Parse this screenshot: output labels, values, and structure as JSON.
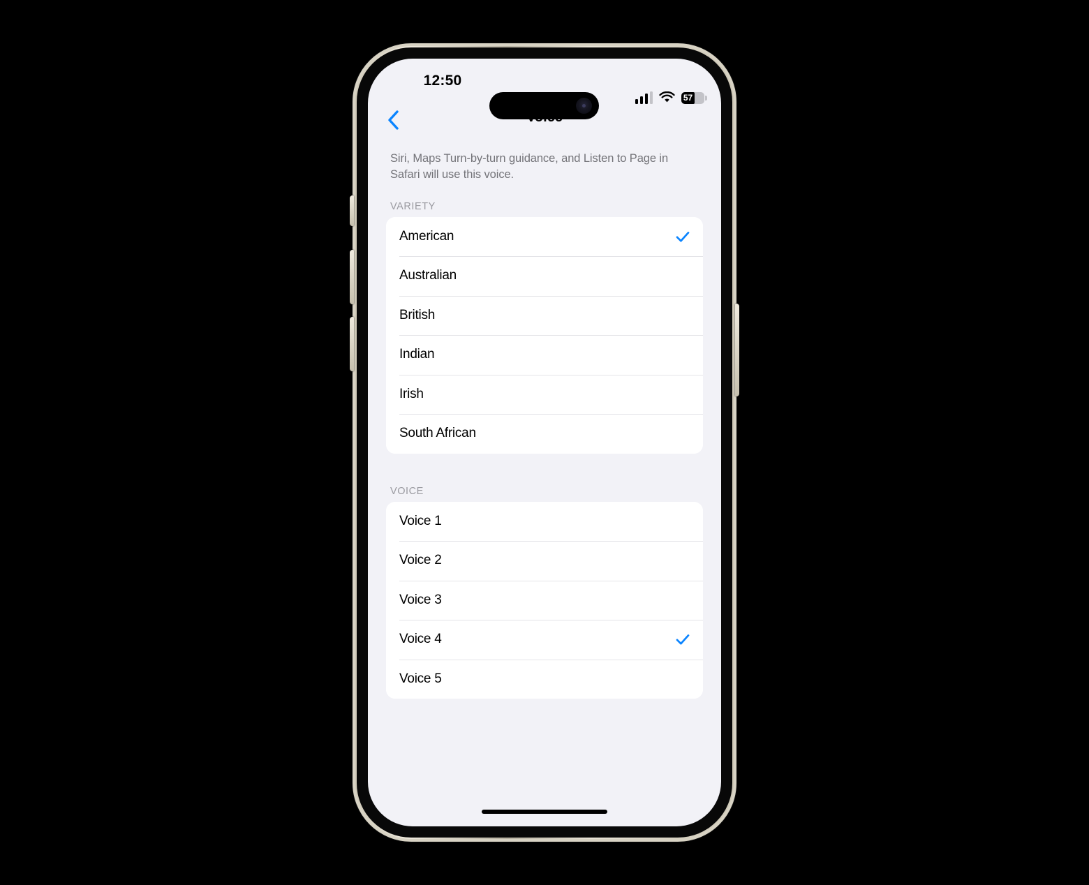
{
  "device": {
    "frame_color": "#d8d3c4",
    "screen_background": "#f2f2f7"
  },
  "status_bar": {
    "time": "12:50",
    "signal_icon": "cellular-bars-icon",
    "signal_bars_filled": 3,
    "signal_bars_total": 4,
    "wifi_icon": "wifi-icon",
    "battery_icon": "battery-icon",
    "battery_percent": "57",
    "battery_level": 57
  },
  "nav": {
    "back_icon": "chevron-left-icon",
    "title": "Voice"
  },
  "content": {
    "footnote": "Siri, Maps Turn-by-turn guidance, and Listen to Page in Safari will use this voice.",
    "accent_color": "#0a84ff",
    "sections": [
      {
        "header": "VARIETY",
        "rows": [
          {
            "label": "American",
            "selected": true
          },
          {
            "label": "Australian",
            "selected": false
          },
          {
            "label": "British",
            "selected": false
          },
          {
            "label": "Indian",
            "selected": false
          },
          {
            "label": "Irish",
            "selected": false
          },
          {
            "label": "South African",
            "selected": false
          }
        ]
      },
      {
        "header": "VOICE",
        "rows": [
          {
            "label": "Voice 1",
            "selected": false
          },
          {
            "label": "Voice 2",
            "selected": false
          },
          {
            "label": "Voice 3",
            "selected": false
          },
          {
            "label": "Voice 4",
            "selected": true
          },
          {
            "label": "Voice 5",
            "selected": false
          }
        ]
      }
    ]
  },
  "home_indicator": "home-indicator"
}
